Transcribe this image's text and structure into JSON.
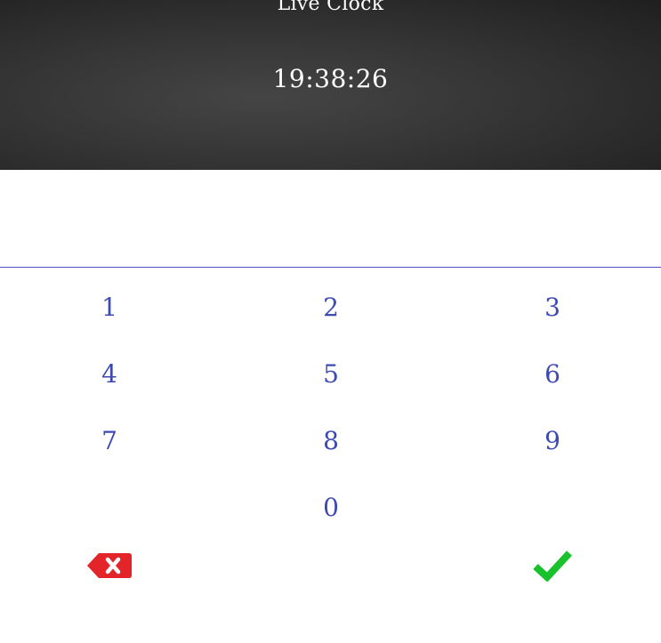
{
  "header": {
    "title": "Live Clock",
    "time": "19:38:26"
  },
  "pin_display": {
    "value": ""
  },
  "keypad": {
    "keys": [
      "1",
      "2",
      "3",
      "4",
      "5",
      "6",
      "7",
      "8",
      "9",
      "0"
    ],
    "backspace_icon": "backspace-icon",
    "confirm_icon": "checkmark-icon"
  },
  "colors": {
    "header_background": "#353535",
    "key_text": "#3d4ab4",
    "divider": "#4b4fbf",
    "backspace": "#e3252a",
    "confirm": "#19c12c"
  }
}
